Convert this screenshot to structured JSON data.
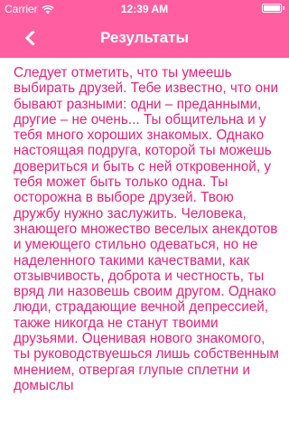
{
  "status_bar": {
    "carrier": "Carrier",
    "time": "12:39 AM",
    "battery_level": 1.0
  },
  "nav_bar": {
    "title": "Результаты",
    "back_icon": "chevron-left-icon"
  },
  "colors": {
    "accent": "#ff5fa0",
    "text": "#e6237a",
    "background": "#ffffff"
  },
  "content": {
    "text": "Следует отметить, что ты умеешь выбирать друзей. Тебе известно, что они бывают разными: одни – преданными, другие – не очень... Ты общительна и у тебя много хороших знакомых. Однако настоящая подруга, которой ты можешь довериться и быть с ней откровенной, у тебя может быть только одна. Ты осторожна в выборе друзей. Твою дружбу нужно заслужить. Человека, знающего множество веселых анекдотов и умеющего стильно одеваться, но не наделенного такими качествами, как отзывчивость, доброта и честность, ты вряд ли назовешь своим другом. Однако люди, страдающие вечной депрессией, также никогда не станут твоими друзьями. Оценивая нового знакомого, ты руководствуешься лишь собственным мнением, отвергая глупые сплетни и домыслы"
  }
}
